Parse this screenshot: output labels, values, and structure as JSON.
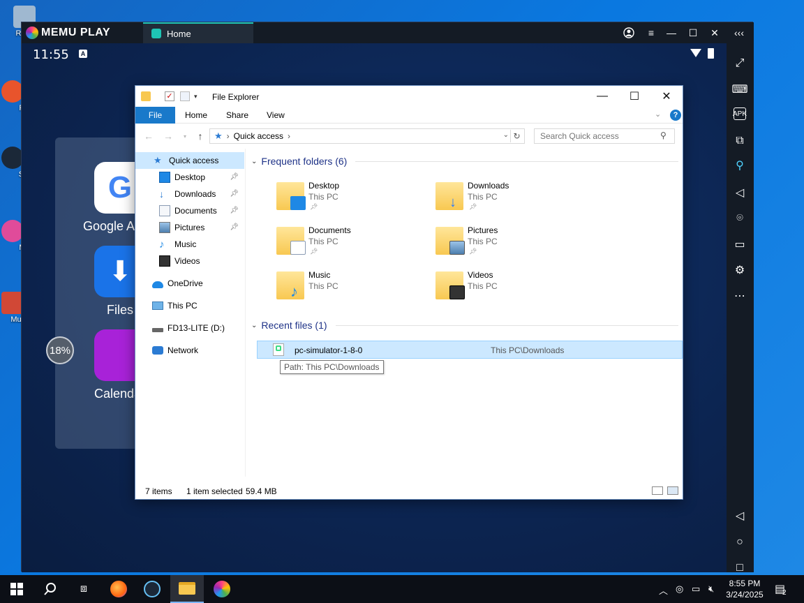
{
  "desktop": {
    "icons": [
      {
        "label": "Recy",
        "color": "#9fb8d0"
      },
      {
        "label": "Fi",
        "color": "#e8542c"
      },
      {
        "label": "St",
        "color": "#1b2838"
      },
      {
        "label": "M",
        "color": "#e04b9a"
      },
      {
        "label": "Multi",
        "color": "#d14836"
      }
    ]
  },
  "memu": {
    "brand": "MEMU PLAY",
    "tab_label": "Home",
    "clock": "11:55",
    "status_badge": "A",
    "memory_percent": "18%",
    "apps": [
      {
        "label": "Google A",
        "color": "#ffffff"
      },
      {
        "label": "Files",
        "color": "#1a73e8"
      },
      {
        "label": "Calenda",
        "color": "#a822d8"
      }
    ],
    "sidebar_icons": [
      "fullscreen-icon",
      "keyboard-icon",
      "apk-icon",
      "add-window-icon",
      "location-search-icon",
      "volume-icon",
      "location-icon",
      "folder-icon",
      "settings-icon",
      "more-icon",
      "back-icon",
      "home-icon",
      "recents-icon"
    ]
  },
  "explorer": {
    "title": "File Explorer",
    "ribbon_tabs": [
      "File",
      "Home",
      "Share",
      "View"
    ],
    "address": "Quick access",
    "search_placeholder": "Search Quick access",
    "nav_items": [
      {
        "label": "Quick access",
        "icon": "star-icon",
        "pinned": false
      },
      {
        "label": "Desktop",
        "icon": "desktop-icon",
        "pinned": true
      },
      {
        "label": "Downloads",
        "icon": "download-icon",
        "pinned": true
      },
      {
        "label": "Documents",
        "icon": "documents-icon",
        "pinned": true
      },
      {
        "label": "Pictures",
        "icon": "pictures-icon",
        "pinned": true
      },
      {
        "label": "Music",
        "icon": "music-icon",
        "pinned": false
      },
      {
        "label": "Videos",
        "icon": "videos-icon",
        "pinned": false
      },
      {
        "label": "OneDrive",
        "icon": "onedrive-icon",
        "pinned": false
      },
      {
        "label": "This PC",
        "icon": "pc-icon",
        "pinned": false
      },
      {
        "label": "FD13-LITE (D:)",
        "icon": "drive-icon",
        "pinned": false
      },
      {
        "label": "Network",
        "icon": "network-icon",
        "pinned": false
      }
    ],
    "frequent_header": "Frequent folders (6)",
    "frequent": [
      {
        "name": "Desktop",
        "location": "This PC",
        "pinned": true,
        "overlay": "#1e88e5"
      },
      {
        "name": "Downloads",
        "location": "This PC",
        "pinned": true,
        "overlay": "#2979ff"
      },
      {
        "name": "Documents",
        "location": "This PC",
        "pinned": true,
        "overlay": "#ffffff"
      },
      {
        "name": "Pictures",
        "location": "This PC",
        "pinned": true,
        "overlay": "#6fa8dc"
      },
      {
        "name": "Music",
        "location": "This PC",
        "pinned": false,
        "overlay": "#1e88e5"
      },
      {
        "name": "Videos",
        "location": "This PC",
        "pinned": false,
        "overlay": "#333333"
      }
    ],
    "recent_header": "Recent files (1)",
    "recent": [
      {
        "name": "pc-simulator-1-8-0",
        "path": "This PC\\Downloads"
      }
    ],
    "tooltip": "Path: This PC\\Downloads",
    "status_items": "7 items",
    "status_selected": "1 item selected",
    "status_size": "59.4 MB"
  },
  "taskbar": {
    "time": "8:55 PM",
    "date": "3/24/2025",
    "notifications": "2"
  },
  "colors": {
    "accent": "#1979ca",
    "selection": "#cce8ff",
    "memu_accent": "#1ec4b4"
  }
}
